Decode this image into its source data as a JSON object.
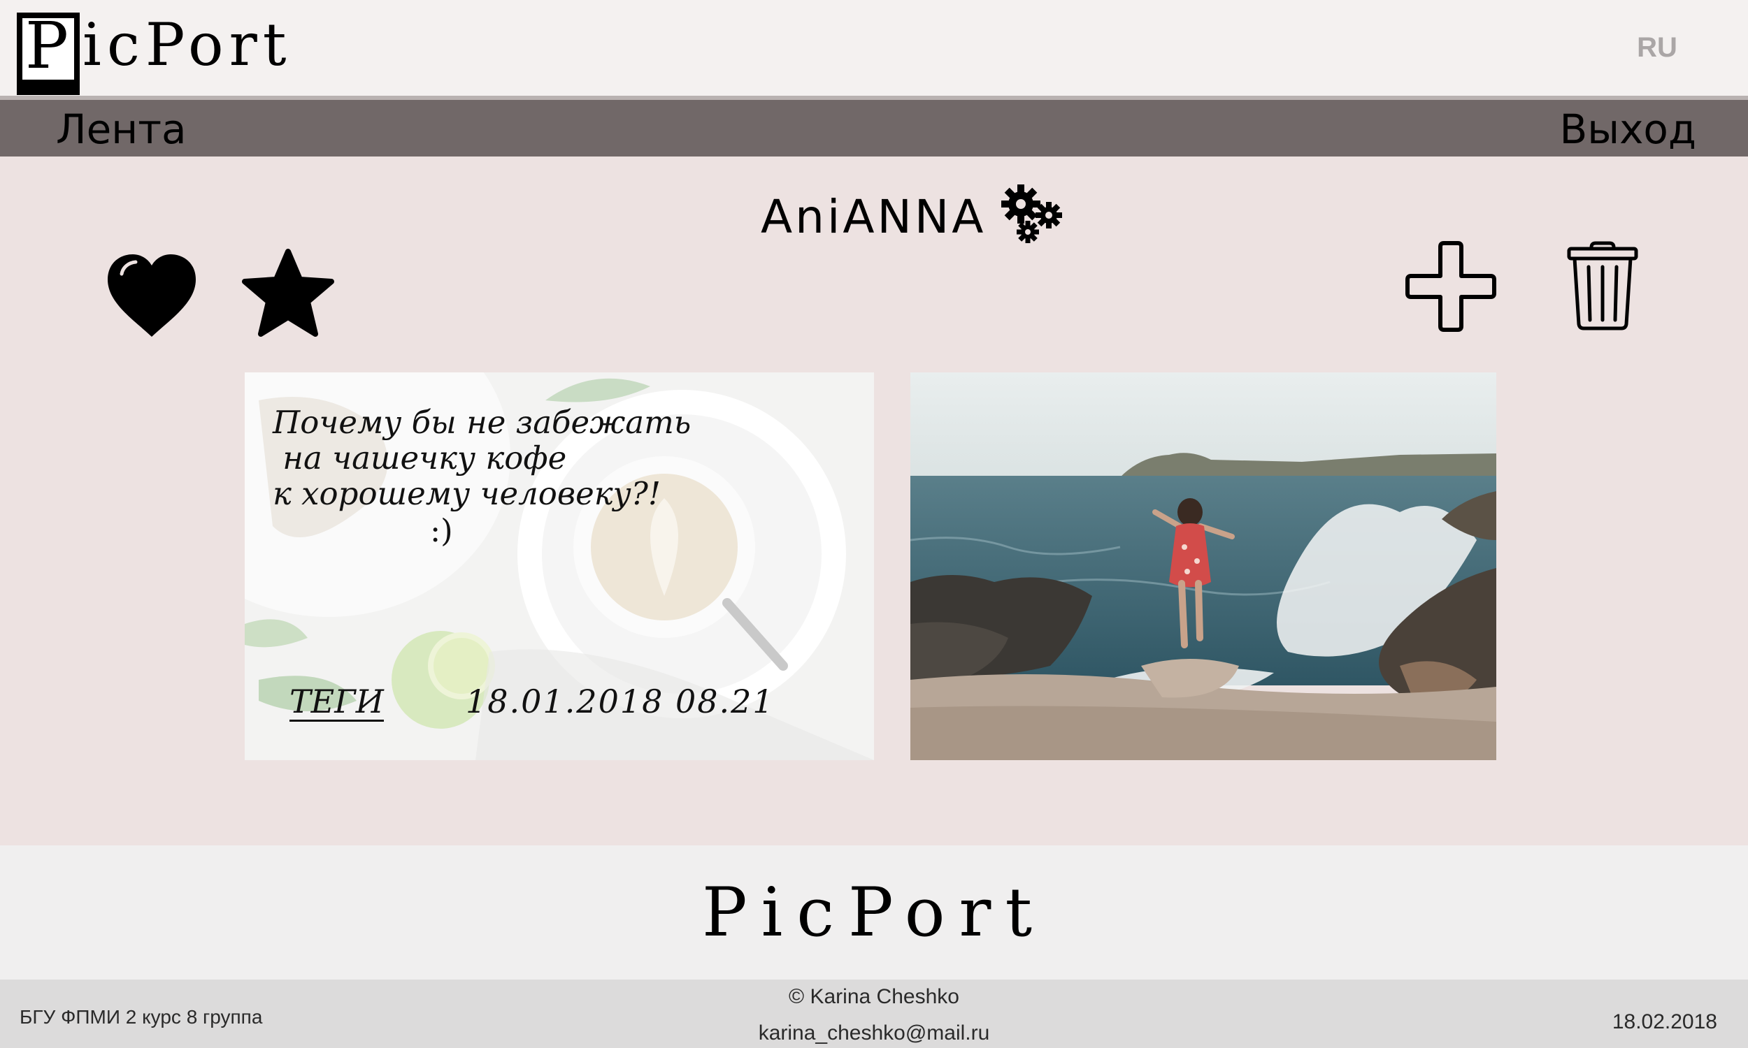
{
  "header": {
    "logo_first_letter": "P",
    "logo_rest": "icPort",
    "language": "RU"
  },
  "nav": {
    "feed_label": "Лента",
    "exit_label": "Выход"
  },
  "profile": {
    "username": "AniANNA",
    "icons": {
      "settings": "gears-icon",
      "likes": "heart-icon",
      "favorites": "star-icon",
      "add": "plus-icon",
      "delete": "trash-icon"
    }
  },
  "posts": {
    "text_post": {
      "text": "Почему бы не забежать\n на чашечку кофе\nк хорошему человеку?!",
      "smile": ":)",
      "tags_label": "ТЕГИ",
      "date": "18.01.2018  08.21"
    }
  },
  "footer": {
    "logo": "PicPort",
    "university": "БГУ ФПМИ 2 курс 8 группа",
    "copyright": "© Karina Cheshko",
    "email": "karina_cheshko@mail.ru",
    "date": "18.02.2018"
  }
}
